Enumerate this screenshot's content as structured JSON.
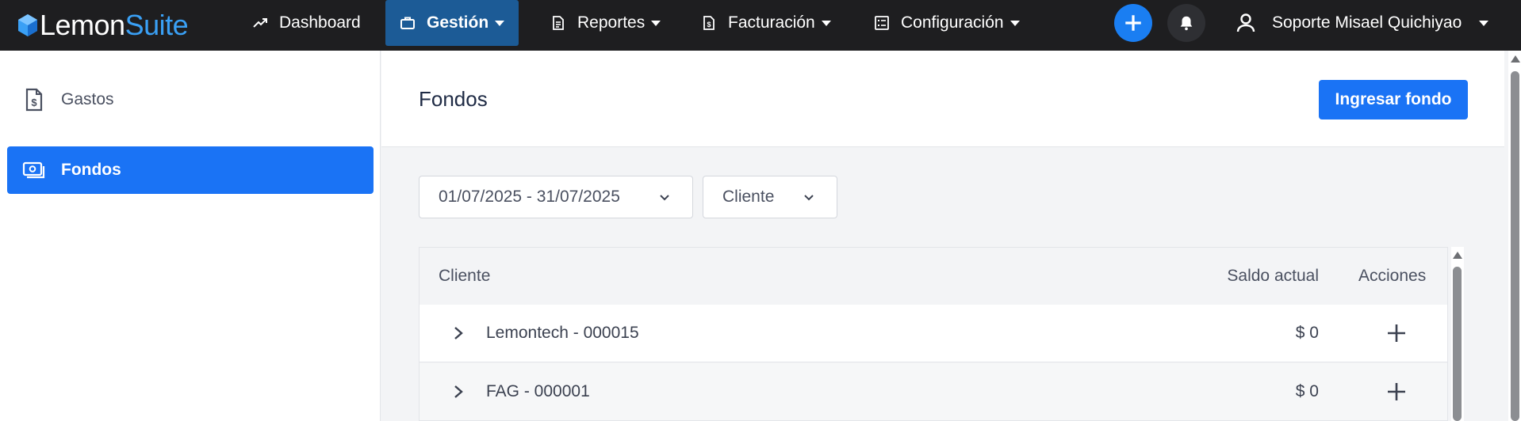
{
  "brand": {
    "part1": "Lemon",
    "part2": "Suite",
    "accent": "#3aa0f5"
  },
  "nav": {
    "items": [
      {
        "label": "Dashboard",
        "icon": "trending-up-icon",
        "has_caret": false,
        "active": false
      },
      {
        "label": "Gestión",
        "icon": "briefcase-icon",
        "has_caret": true,
        "active": true
      },
      {
        "label": "Reportes",
        "icon": "document-icon",
        "has_caret": true,
        "active": false
      },
      {
        "label": "Facturación",
        "icon": "invoice-icon",
        "has_caret": true,
        "active": false
      },
      {
        "label": "Configuración",
        "icon": "settings-list-icon",
        "has_caret": true,
        "active": false
      }
    ],
    "user_name": "Soporte Misael Quichiyao"
  },
  "sidebar": {
    "items": [
      {
        "label": "Gastos",
        "icon": "receipt-dollar-icon",
        "active": false
      },
      {
        "label": "Fondos",
        "icon": "money-icon",
        "active": true
      }
    ]
  },
  "page": {
    "title": "Fondos",
    "primary_action": "Ingresar fondo"
  },
  "filters": {
    "date_range": "01/07/2025 - 31/07/2025",
    "client": "Cliente"
  },
  "table": {
    "columns": {
      "client": "Cliente",
      "balance": "Saldo actual",
      "actions": "Acciones"
    },
    "rows": [
      {
        "client": "Lemontech - 000015",
        "balance": "$ 0"
      },
      {
        "client": "FAG - 000001",
        "balance": "$ 0"
      }
    ]
  },
  "colors": {
    "topbar": "#1e1e20",
    "nav_active": "#1c5b96",
    "primary": "#1a73f5",
    "fab": "#1a7ef2"
  }
}
